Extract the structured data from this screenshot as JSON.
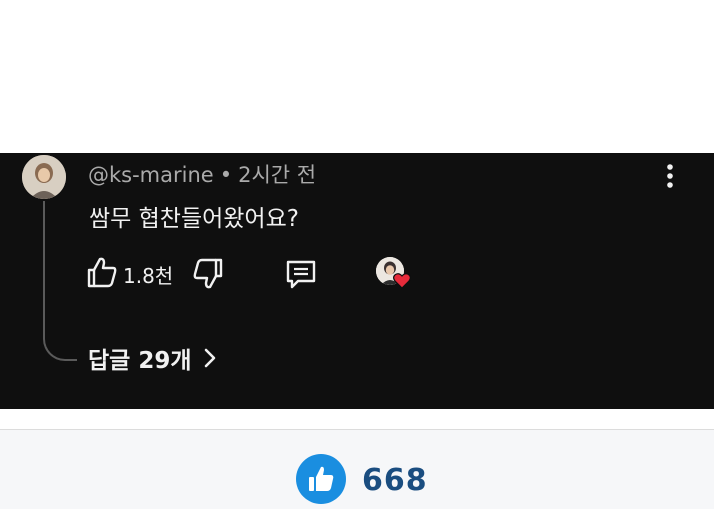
{
  "comment": {
    "username": "@ks-marine",
    "separator": "•",
    "time": "2시간 전",
    "text": "쌈무 협찬들어왔어요?",
    "like_count": "1.8천",
    "replies_label": "답글 29개"
  },
  "bottom": {
    "like_count": "668"
  },
  "colors": {
    "panel_bg": "#0f0f0f",
    "text_primary": "#f1f1f1",
    "text_secondary": "#aaaaaa",
    "heart_red": "#e62b3b",
    "like_blue": "#1a8ee0",
    "count_blue": "#1a4d80"
  },
  "icons": {
    "kebab": "more-vert-icon",
    "like": "thumb-up-icon",
    "dislike": "thumb-down-icon",
    "reply": "reply-icon",
    "creator_heart": "creator-heart-icon",
    "chevron": "chevron-right-icon",
    "bottom_like": "thumb-up-filled-icon"
  }
}
